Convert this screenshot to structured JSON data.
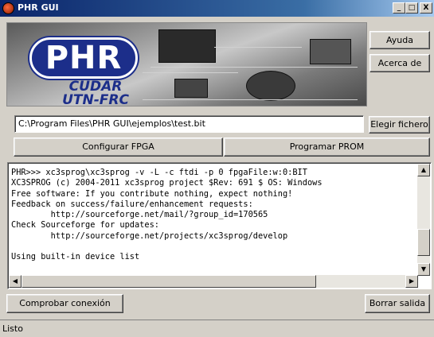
{
  "window": {
    "title": "PHR GUI"
  },
  "titlebar": {
    "minimize": "_",
    "maximize": "□",
    "close": "X"
  },
  "banner": {
    "logo": "PHR",
    "subtitle_line1": "CUDAR",
    "subtitle_line2": "UTN-FRC"
  },
  "buttons": {
    "ayuda": "Ayuda",
    "acerca": "Acerca de",
    "elegir": "Elegir fichero",
    "configurar": "Configurar FPGA",
    "programar": "Programar PROM",
    "comprobar": "Comprobar conexión",
    "borrar": "Borrar salida"
  },
  "file_field": {
    "value": "C:\\Program Files\\PHR GUI\\ejemplos\\test.bit"
  },
  "console": {
    "text": "PHR>>> xc3sprog\\xc3sprog -v -L -c ftdi -p 0 fpgaFile:w:0:BIT\nXC3SPROG (c) 2004-2011 xc3sprog project $Rev: 691 $ OS: Windows\nFree software: If you contribute nothing, expect nothing!\nFeedback on success/failure/enhancement requests:\n        http://sourceforge.net/mail/?group_id=170565\nCheck Sourceforge for updates:\n        http://sourceforge.net/projects/xc3sprog/develop\n\nUsing built-in device list"
  },
  "status": {
    "text": "Listo"
  }
}
